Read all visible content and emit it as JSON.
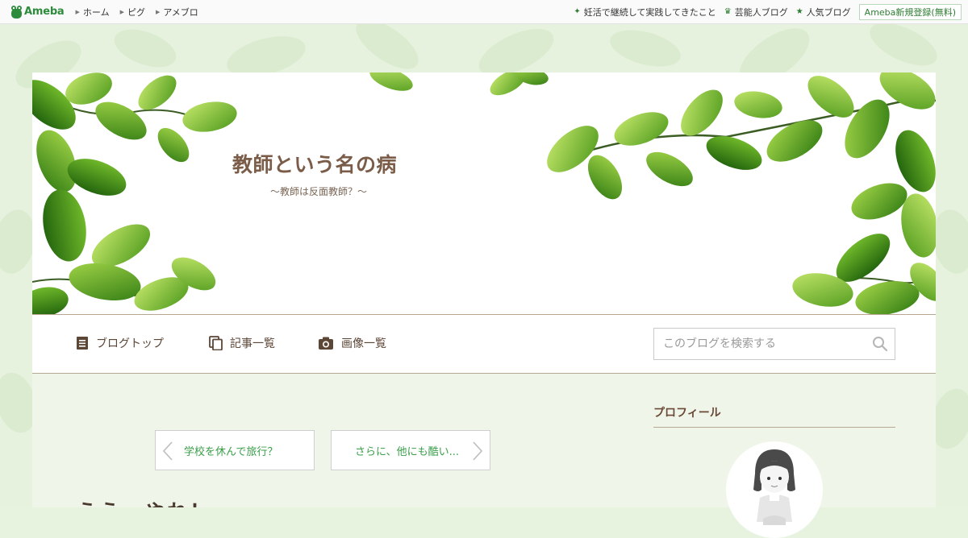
{
  "topbar": {
    "logo_text": "Ameba",
    "nav": [
      {
        "label": "ホーム"
      },
      {
        "label": "ピグ"
      },
      {
        "label": "アメブロ"
      }
    ],
    "right_links": [
      {
        "label": "妊活で継続して実践してきたこと",
        "icon": "sparkle-icon"
      },
      {
        "label": "芸能人ブログ",
        "icon": "crown-icon"
      },
      {
        "label": "人気ブログ",
        "icon": "star-icon"
      }
    ],
    "register_label": "Ameba新規登録(無料)"
  },
  "header": {
    "title": "教師という名の病",
    "subtitle": "〜教師は反面教師？〜"
  },
  "blog_nav": {
    "items": [
      {
        "label": "ブログトップ",
        "icon": "document-icon"
      },
      {
        "label": "記事一覧",
        "icon": "copy-icon"
      },
      {
        "label": "画像一覧",
        "icon": "camera-icon"
      }
    ],
    "search_placeholder": "このブログを検索する"
  },
  "content": {
    "prev_entry": "学校を休んで旅行？",
    "next_entry": "さらに、他にも酷い...",
    "entry_title": "ええ　やれ！"
  },
  "sidebar": {
    "profile_heading": "プロフィール"
  },
  "colors": {
    "accent_green": "#2e7d32",
    "title_brown": "#7a5c48",
    "link_green": "#3aa04a",
    "content_bg": "#f0f5ea"
  }
}
